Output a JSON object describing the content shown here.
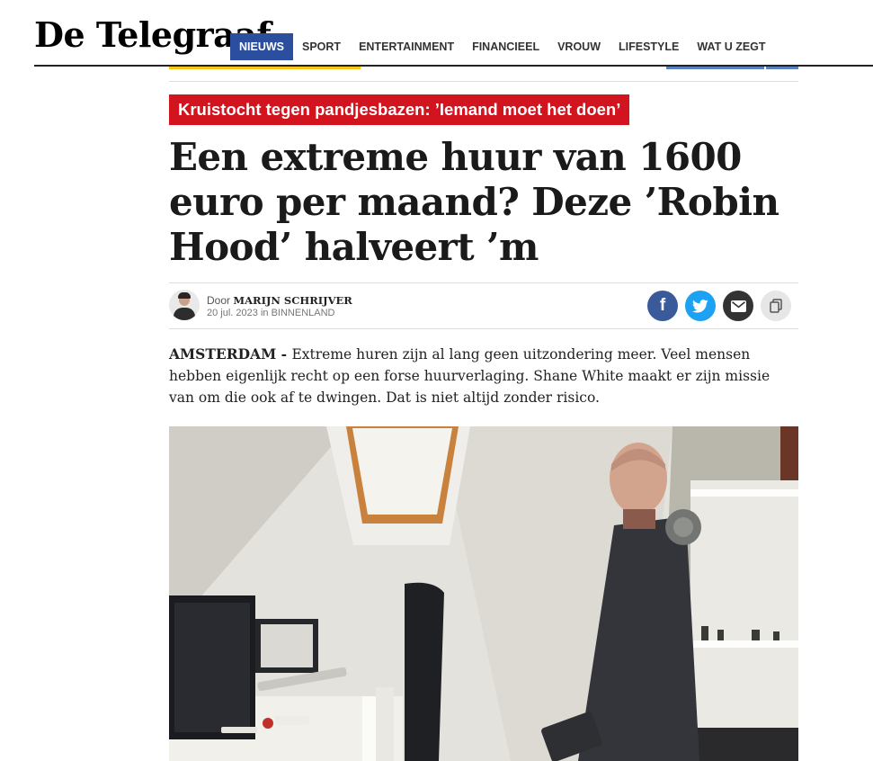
{
  "header": {
    "logo_text": "De Telegraaf",
    "nav": [
      {
        "label": "NIEUWS",
        "active": true
      },
      {
        "label": "SPORT",
        "active": false
      },
      {
        "label": "ENTERTAINMENT",
        "active": false
      },
      {
        "label": "FINANCIEEL",
        "active": false
      },
      {
        "label": "VROUW",
        "active": false
      },
      {
        "label": "LIFESTYLE",
        "active": false
      },
      {
        "label": "WAT U ZEGT",
        "active": false
      }
    ]
  },
  "article": {
    "kicker": "Kruistocht tegen pandjesbazen: ’Iemand moet het doen’",
    "headline": "Een extreme huur van 1600 euro per maand? Deze ’Robin Hood’ halveert ’m",
    "byline": {
      "prefix": "Door",
      "author": "MARIJN SCHRIJVER",
      "date": "20 jul. 2023",
      "in_label": "in",
      "section": "BINNENLAND"
    },
    "share": {
      "facebook_icon": "facebook-icon",
      "twitter_icon": "twitter-icon",
      "email_icon": "email-icon",
      "copy_icon": "copy-link-icon"
    },
    "intro_dateline": "AMSTERDAM - ",
    "intro_text": "Extreme huren zijn al lang geen uitzondering meer. Veel mensen hebben eigenlijk recht op een forse huurverlaging. Shane White maakt er zijn missie van om die ook af te dwingen. Dat is niet altijd zonder risico."
  },
  "colors": {
    "nav_active": "#2b4f9e",
    "kicker_bg": "#d2141e",
    "facebook": "#3a5a99",
    "twitter": "#1da1f2",
    "email": "#333333",
    "copy": "#e6e6e6",
    "accent_yellow": "#f5c518"
  }
}
